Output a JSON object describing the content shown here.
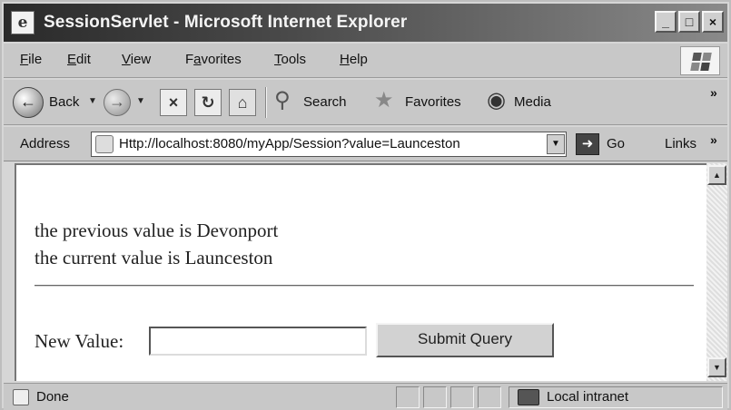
{
  "window": {
    "title": "SessionServlet - Microsoft Internet Explorer",
    "controls": {
      "minimize": "_",
      "maximize": "□",
      "close": "×"
    }
  },
  "menu": {
    "items": [
      {
        "pre": "",
        "u": "F",
        "post": "ile"
      },
      {
        "pre": "",
        "u": "E",
        "post": "dit"
      },
      {
        "pre": "",
        "u": "V",
        "post": "iew"
      },
      {
        "pre": "F",
        "u": "a",
        "post": "vorites"
      },
      {
        "pre": "",
        "u": "T",
        "post": "ools"
      },
      {
        "pre": "",
        "u": "H",
        "post": "elp"
      }
    ]
  },
  "toolbar": {
    "back_label": "Back",
    "search_label": "Search",
    "favorites_label": "Favorites",
    "media_label": "Media",
    "overflow": "»"
  },
  "address": {
    "label": "Address",
    "url": "Http://localhost:8080/myApp/Session?value=Launceston",
    "go_label": "Go",
    "links_label": "Links",
    "overflow": "»"
  },
  "page": {
    "previous_line": "the previous value is Devonport",
    "current_line": "the current value is Launceston",
    "form": {
      "label": "New Value:",
      "input_value": "",
      "submit_label": "Submit Query"
    }
  },
  "status": {
    "text": "Done",
    "zone": "Local intranet"
  },
  "icons": {
    "back": "back-arrow-icon",
    "forward": "forward-arrow-icon",
    "stop": "stop-icon",
    "refresh": "refresh-icon",
    "home": "home-icon",
    "search": "search-magnifier-icon",
    "favorites": "favorites-star-icon",
    "media": "media-icon"
  }
}
